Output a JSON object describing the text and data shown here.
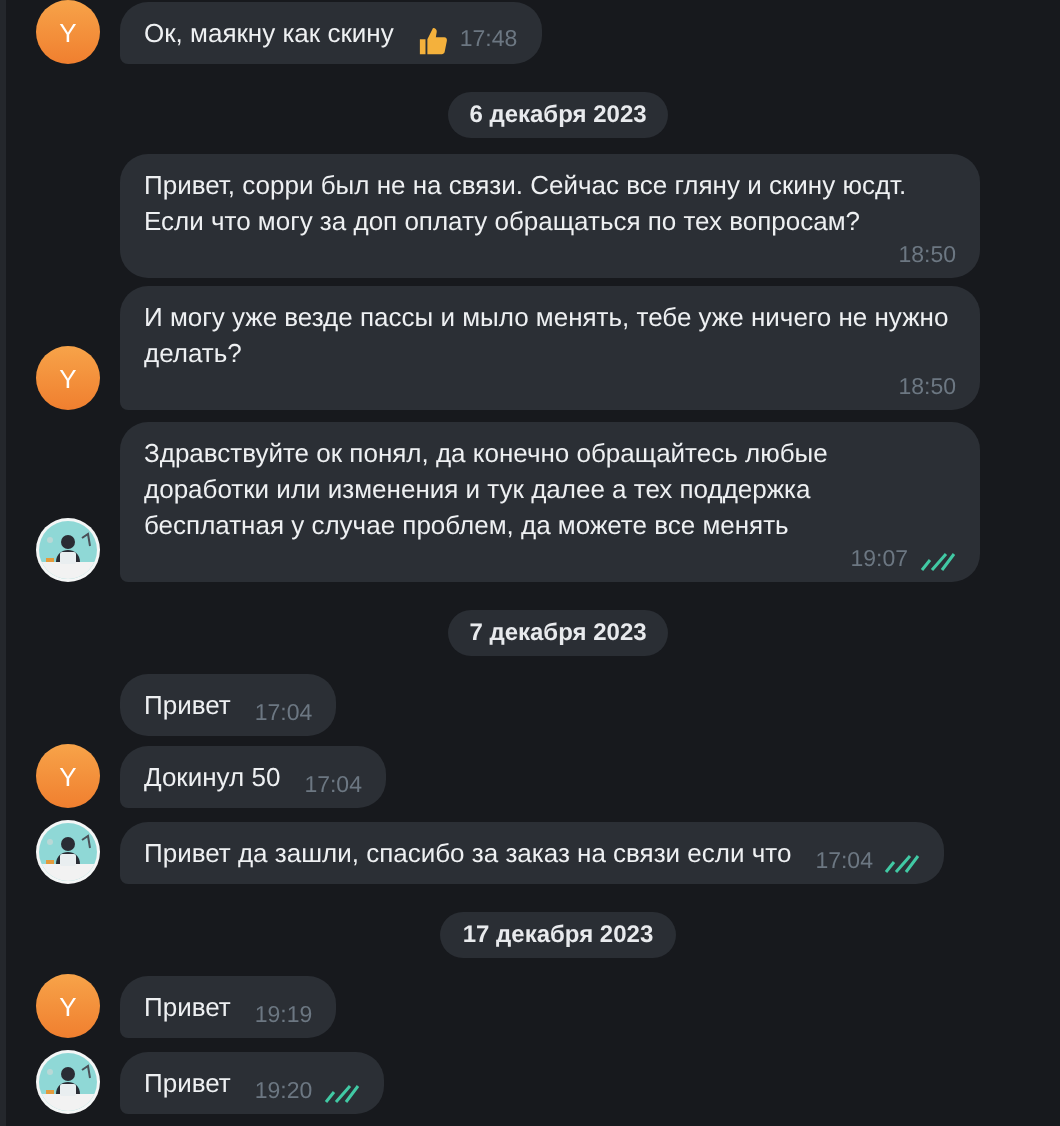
{
  "feed": [
    {
      "kind": "message",
      "text": "Ок, маякну как скину",
      "time": "17:48",
      "liked": true,
      "read": false,
      "avatar": {
        "kind": "letter",
        "letter": "Y"
      }
    },
    {
      "kind": "date",
      "text": "6 декабря 2023"
    },
    {
      "kind": "message",
      "text": "Привет, сорри был не на связи. Сейчас все гляну и скину юсдт. Если что могу за доп оплату обращаться по тех вопросам?",
      "time": "18:50",
      "liked": false,
      "read": false
    },
    {
      "kind": "message",
      "text": "И могу уже везде пассы и мыло менять, тебе уже ничего не нужно делать?",
      "time": "18:50",
      "liked": false,
      "read": false,
      "avatar": {
        "kind": "letter",
        "letter": "Y"
      }
    },
    {
      "kind": "message",
      "text": "Здравствуйте ок понял, да конечно обращайтесь любые доработки или изменения и тук далее а тех поддержка бесплатная у случае проблем, да можете все менять",
      "time": "19:07",
      "liked": false,
      "read": true
    },
    {
      "kind": "date",
      "text": "7 декабря 2023"
    },
    {
      "kind": "message",
      "text": "Привет",
      "time": "17:04",
      "liked": false,
      "read": false
    },
    {
      "kind": "message",
      "text": "Докинул 50",
      "time": "17:04",
      "liked": false,
      "read": false,
      "avatar": {
        "kind": "letter",
        "letter": "Y"
      }
    },
    {
      "kind": "message",
      "text": "Привет да зашли, спасибо за заказ на связи если что",
      "time": "17:04",
      "liked": false,
      "read": true
    },
    {
      "kind": "date",
      "text": "17 декабря 2023"
    },
    {
      "kind": "message",
      "text": "Привет",
      "time": "19:19",
      "liked": false,
      "read": false,
      "avatar": {
        "kind": "letter",
        "letter": "Y"
      }
    },
    {
      "kind": "message",
      "text": "Привет",
      "time": "19:20",
      "liked": false,
      "read": true
    }
  ]
}
